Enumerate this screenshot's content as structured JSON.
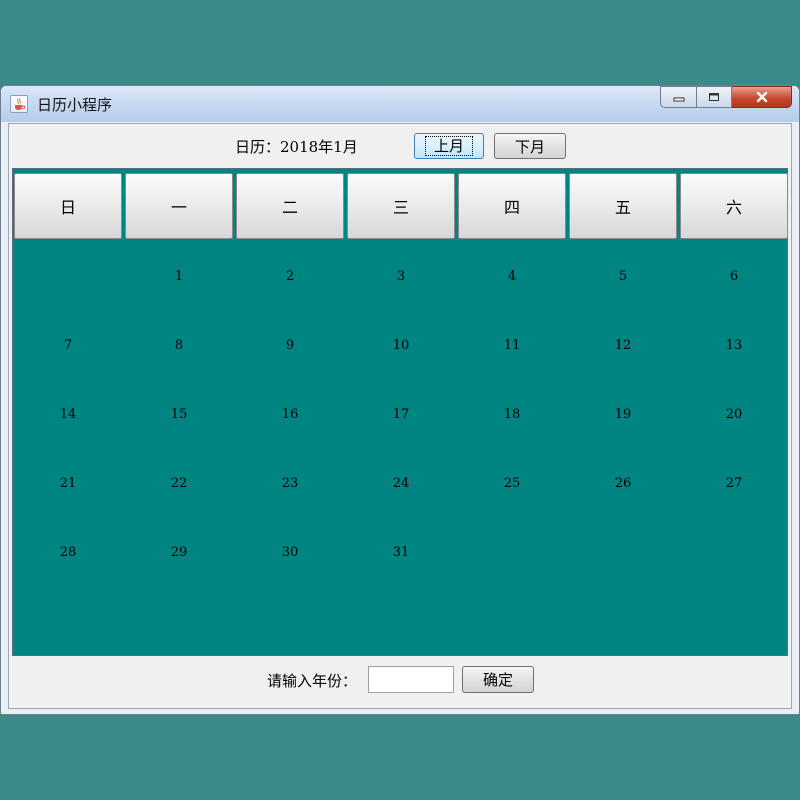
{
  "window": {
    "title": "日历小程序",
    "icon": "java-cup-icon",
    "controls": {
      "minimize": "minimize-icon",
      "maximize": "maximize-icon",
      "close": "close-icon"
    }
  },
  "header": {
    "calendar_label": "日历：2018年1月",
    "prev_button": "上月",
    "next_button": "下月"
  },
  "weekdays": [
    "日",
    "一",
    "二",
    "三",
    "四",
    "五",
    "六"
  ],
  "days": [
    [
      "",
      "1",
      "2",
      "3",
      "4",
      "5",
      "6"
    ],
    [
      "7",
      "8",
      "9",
      "10",
      "11",
      "12",
      "13"
    ],
    [
      "14",
      "15",
      "16",
      "17",
      "18",
      "19",
      "20"
    ],
    [
      "21",
      "22",
      "23",
      "24",
      "25",
      "26",
      "27"
    ],
    [
      "28",
      "29",
      "30",
      "31",
      "",
      "",
      ""
    ]
  ],
  "footer": {
    "input_label": "请输入年份：",
    "input_value": "",
    "confirm_button": "确定"
  },
  "colors": {
    "desktop": "#3a8a87",
    "grid_background": "#008582"
  }
}
